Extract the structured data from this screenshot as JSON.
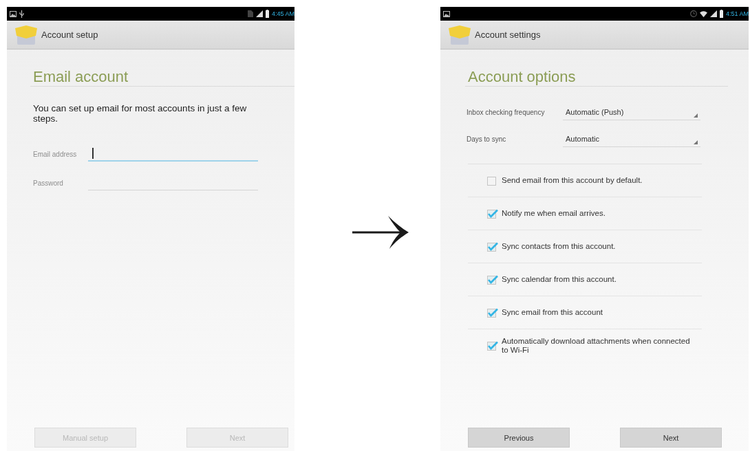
{
  "screens": [
    {
      "status_bar": {
        "time": "4:45 AM"
      },
      "action_bar": {
        "title": "Account setup"
      },
      "heading": "Email account",
      "description": "You can set up email for most accounts in just a few steps.",
      "fields": [
        {
          "label": "Email address",
          "focused": true
        },
        {
          "label": "Password",
          "focused": false
        }
      ],
      "buttons": [
        {
          "label": "Manual setup",
          "disabled": true
        },
        {
          "label": "Next",
          "disabled": true
        }
      ]
    },
    {
      "status_bar": {
        "time": "4:51 AM"
      },
      "action_bar": {
        "title": "Account settings"
      },
      "heading": "Account options",
      "settings": [
        {
          "label": "Inbox checking frequency",
          "value": "Automatic (Push)"
        },
        {
          "label": "Days to sync",
          "value": "Automatic"
        }
      ],
      "options": [
        {
          "label": "Send email from this account by default.",
          "checked": false
        },
        {
          "label": "Notify me when email arrives.",
          "checked": true
        },
        {
          "label": "Sync contacts from this account.",
          "checked": true
        },
        {
          "label": "Sync calendar from this account.",
          "checked": true
        },
        {
          "label": "Sync email from this account",
          "checked": true
        },
        {
          "label": "Automatically download attachments when connected to Wi-Fi",
          "checked": true
        }
      ],
      "buttons": [
        {
          "label": "Previous",
          "disabled": false
        },
        {
          "label": "Next",
          "disabled": false
        }
      ]
    }
  ]
}
